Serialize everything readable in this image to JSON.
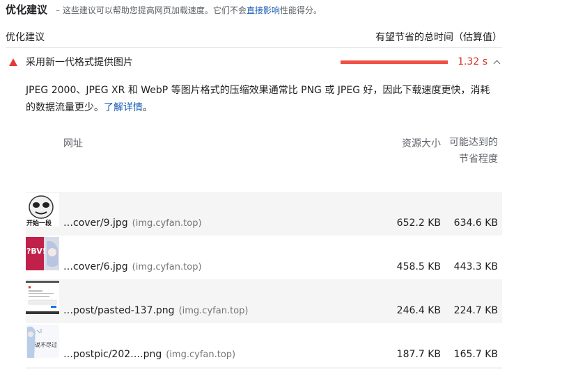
{
  "header": {
    "title": "优化建议",
    "desc_prefix": "– 这些建议可以帮助您提高网页加载速度。它们不会",
    "desc_link": "直接影响",
    "desc_suffix": "性能得分。"
  },
  "columns": {
    "left": "优化建议",
    "right": "有望节省的总时间（估算值）"
  },
  "audit": {
    "title": "采用新一代格式提供图片",
    "value": "1.32 s",
    "savings_fraction": 1.0,
    "status_color": "#e53935",
    "icon": "fail-triangle-icon"
  },
  "description": {
    "text": "JPEG 2000、JPEG XR 和 WebP 等图片格式的压缩效果通常比 PNG 或 JPEG 好，因此下载速度更快，消耗的数据流量更少。",
    "link": "了解详情",
    "suffix": "。"
  },
  "table": {
    "headers": {
      "url": "网址",
      "size": "资源大小",
      "savings": "可能达到的节省程度"
    },
    "rows": [
      {
        "url": "…cover/9.jpg",
        "origin": "(img.cyfan.top)",
        "size": "652.2 KB",
        "savings": "634.6 KB",
        "thumb": "face-sticker-thumbnail",
        "thumb_text": "开始一段"
      },
      {
        "url": "…cover/6.jpg",
        "origin": "(img.cyfan.top)",
        "size": "458.5 KB",
        "savings": "443.3 KB",
        "thumb": "anime-red-thumbnail",
        "thumb_text": "?BV!"
      },
      {
        "url": "…post/pasted-137.png",
        "origin": "(img.cyfan.top)",
        "size": "246.4 KB",
        "savings": "224.7 KB",
        "thumb": "screenshot-thumbnail"
      },
      {
        "url": "…postpic/202….png",
        "origin": "(img.cyfan.top)",
        "size": "187.7 KB",
        "savings": "165.7 KB",
        "thumb": "anime-blue-thumbnail",
        "thumb_text": "说不尽过"
      }
    ]
  }
}
